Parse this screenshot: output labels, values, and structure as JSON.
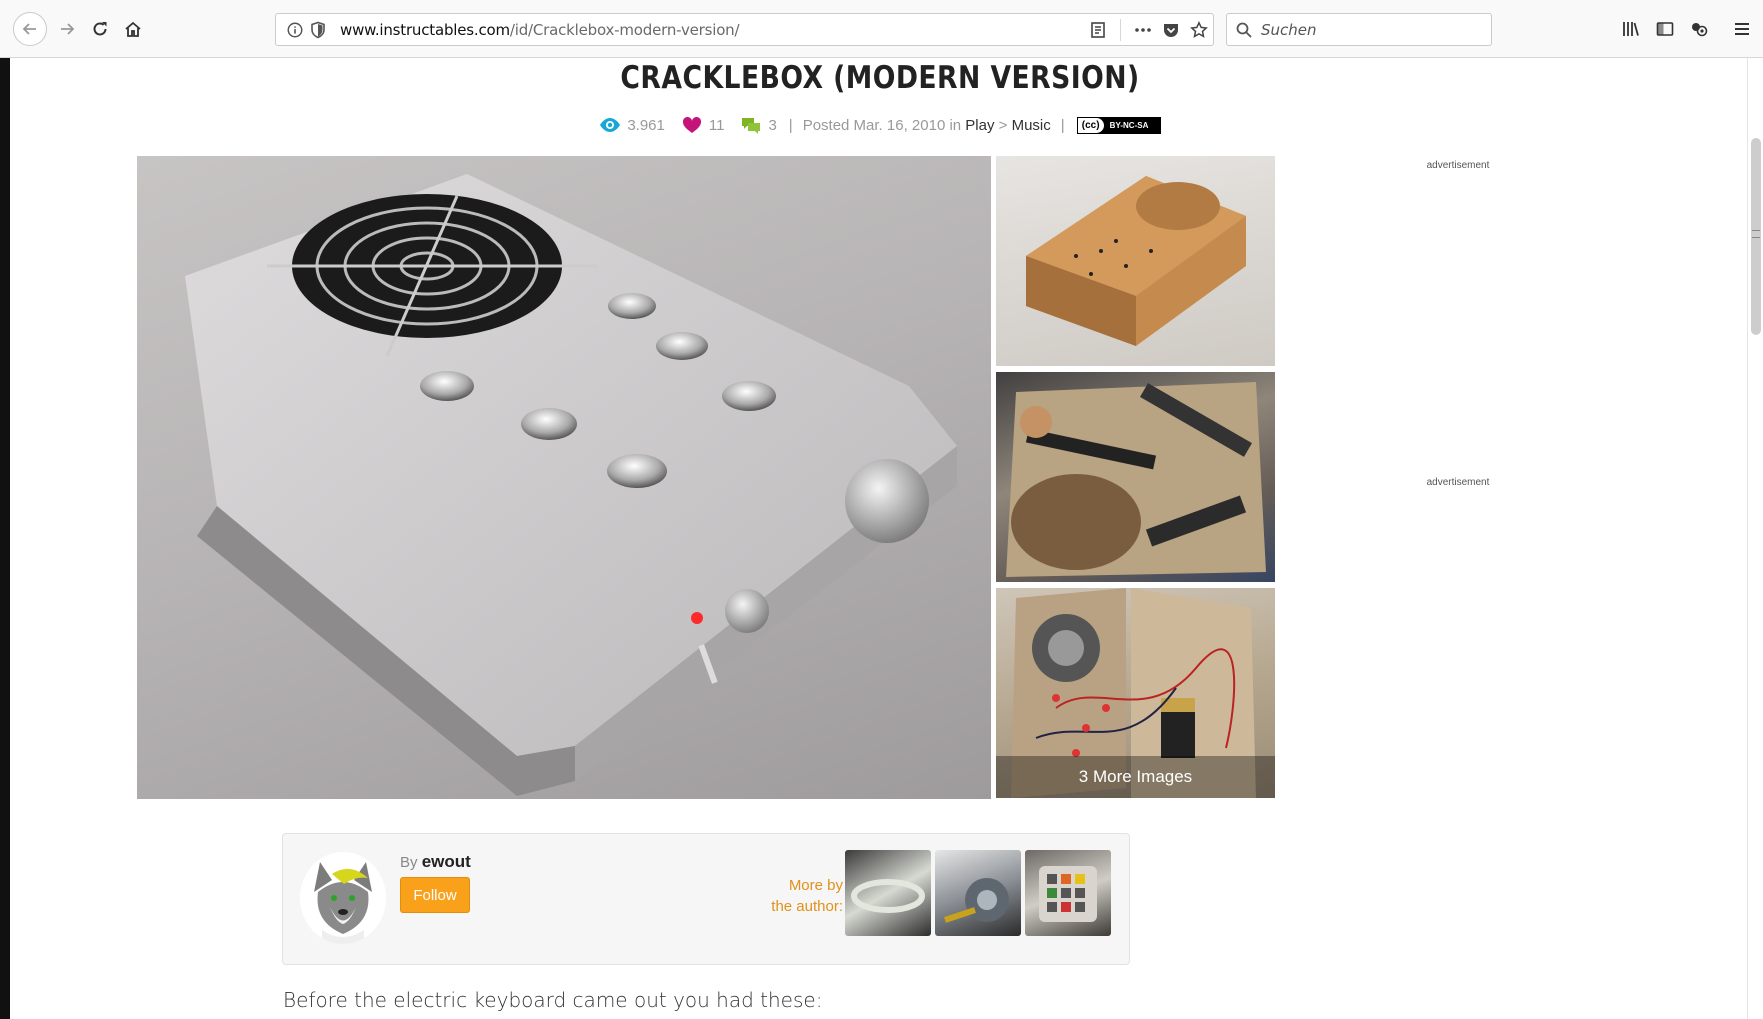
{
  "browser": {
    "url_host": "www.instructables.com",
    "url_path": "/id/Cracklebox-modern-version/",
    "search_placeholder": "Suchen"
  },
  "article": {
    "title": "CRACKLEBOX (MODERN VERSION)",
    "views": "3.961",
    "favorites": "11",
    "comments": "3",
    "posted": "Posted Mar. 16, 2010 in",
    "category": "Play",
    "category_sep": ">",
    "subcategory": "Music",
    "license_left": "(cc)",
    "license_right": "BY-NC-SA",
    "more_images": "3 More Images",
    "intro": "Before the electric keyboard came out you had these:"
  },
  "ads": {
    "label_1": "advertisement",
    "label_2": "advertisement"
  },
  "author": {
    "by": "By",
    "name": "ewout",
    "follow_label": "Follow",
    "more_by_line1": "More by",
    "more_by_line2": "the author:"
  },
  "colors": {
    "accent_blue": "#1aa7d6",
    "heart_pink": "#c4147a",
    "comment_green": "#7fb522",
    "follow_orange": "#f9a11b"
  }
}
